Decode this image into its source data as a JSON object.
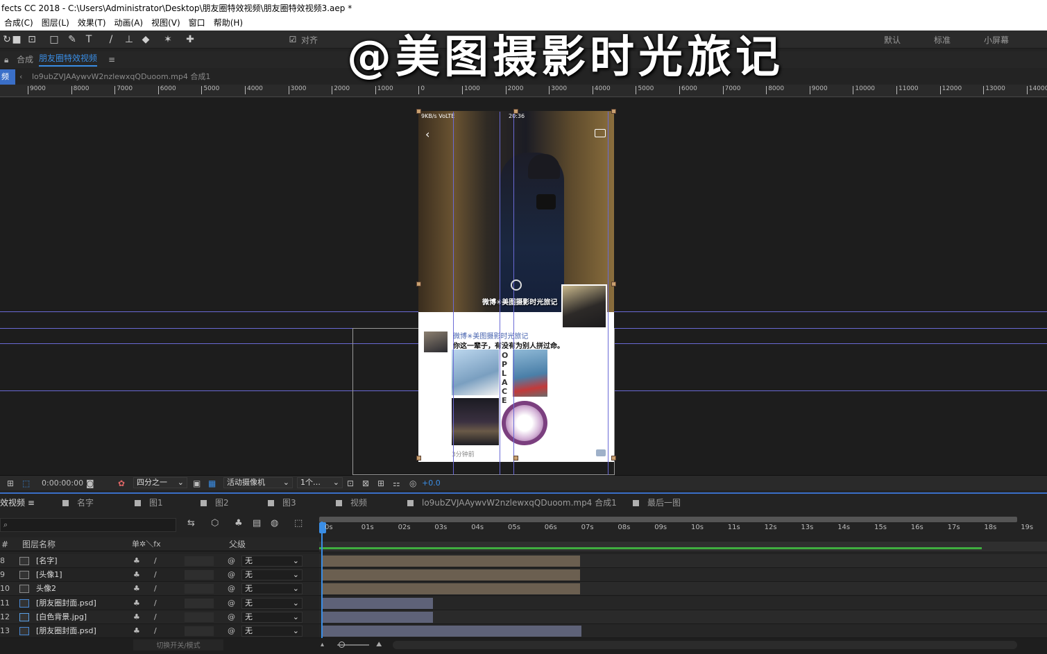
{
  "window": {
    "title": "fects CC 2018 - C:\\Users\\Administrator\\Desktop\\朋友圈特效视频\\朋友圈特效视频3.aep *"
  },
  "menu": [
    "合成(C)",
    "图层(L)",
    "效果(T)",
    "动画(A)",
    "视图(V)",
    "窗口",
    "帮助(H)"
  ],
  "toolbar": {
    "align_label": "对齐",
    "workspaces": [
      "默认",
      "标准",
      "小屏幕"
    ]
  },
  "watermark": "@美图摄影时光旅记",
  "comp_panel": {
    "label": "合成",
    "comp_name": "朋友圈特效视频",
    "menu_glyph": "≡",
    "left_tab": "频",
    "breadcrumb": "lo9ubZVJAAywvW2nzlewxqQDuoom.mp4 合成1"
  },
  "ruler": {
    "ticks": [
      "9000",
      "8000",
      "7000",
      "6000",
      "5000",
      "4000",
      "3000",
      "2000",
      "1000",
      "0",
      "1000",
      "2000",
      "3000",
      "4000",
      "5000",
      "6000",
      "7000",
      "8000",
      "9000",
      "10000",
      "11000",
      "12000",
      "13000",
      "14000"
    ]
  },
  "phone": {
    "status": "9KB/s VoLTE",
    "clock": "20:36",
    "nickname": "微博✳美图摄影时光旅记",
    "post_name": "微博✳美图摄影时光旅记",
    "post_text": "你这一辈子，有没有为别人拼过命。",
    "vertical_text": "OPLACE",
    "time_ago": "3分钟前"
  },
  "viewer_controls": {
    "timecode": "0:00:00:00",
    "resolution": "四分之一",
    "camera": "活动摄像机",
    "views": "1个…",
    "exposure": "+0.0"
  },
  "timeline": {
    "tabs": [
      {
        "label": "效视频",
        "color": "#b0b0b0"
      },
      {
        "label": "名字",
        "color": "#b0b0b0"
      },
      {
        "label": "图1",
        "color": "#b0b0b0"
      },
      {
        "label": "图2",
        "color": "#b0b0b0"
      },
      {
        "label": "图3",
        "color": "#b0b0b0"
      },
      {
        "label": "视频",
        "color": "#b0b0b0"
      },
      {
        "label": "lo9ubZVJAAywvW2nzlewxqQDuoom.mp4 合成1",
        "color": "#b0b0b0"
      },
      {
        "label": "最后一图",
        "color": "#b0b0b0"
      }
    ],
    "columns": {
      "num": "#",
      "name": "图层名称",
      "switches": "单✲＼fx",
      "parent": "父级"
    },
    "seconds": [
      "0s",
      "01s",
      "02s",
      "03s",
      "04s",
      "05s",
      "06s",
      "07s",
      "08s",
      "09s",
      "10s",
      "11s",
      "12s",
      "13s",
      "14s",
      "15s",
      "16s",
      "17s",
      "18s",
      "19s"
    ],
    "layers": [
      {
        "num": "8",
        "name": "[名字]",
        "parent": "无",
        "type": "comp"
      },
      {
        "num": "9",
        "name": "[头像1]",
        "parent": "无",
        "type": "comp"
      },
      {
        "num": "10",
        "name": "头像2",
        "parent": "无",
        "type": "comp"
      },
      {
        "num": "11",
        "name": "[朋友圈封面.psd]",
        "parent": "无",
        "type": "psd"
      },
      {
        "num": "12",
        "name": "[白色背景.jpg]",
        "parent": "无",
        "type": "jpg"
      },
      {
        "num": "13",
        "name": "[朋友圈封面.psd]",
        "parent": "无",
        "type": "psd"
      }
    ],
    "footer": "切换开关/模式"
  },
  "colors": {
    "accent": "#3a6fc8",
    "guide": "#6a6ad6",
    "bar_comp": "#6b5f50",
    "bar_footage": "#5e6278",
    "green": "#3fae3f"
  }
}
